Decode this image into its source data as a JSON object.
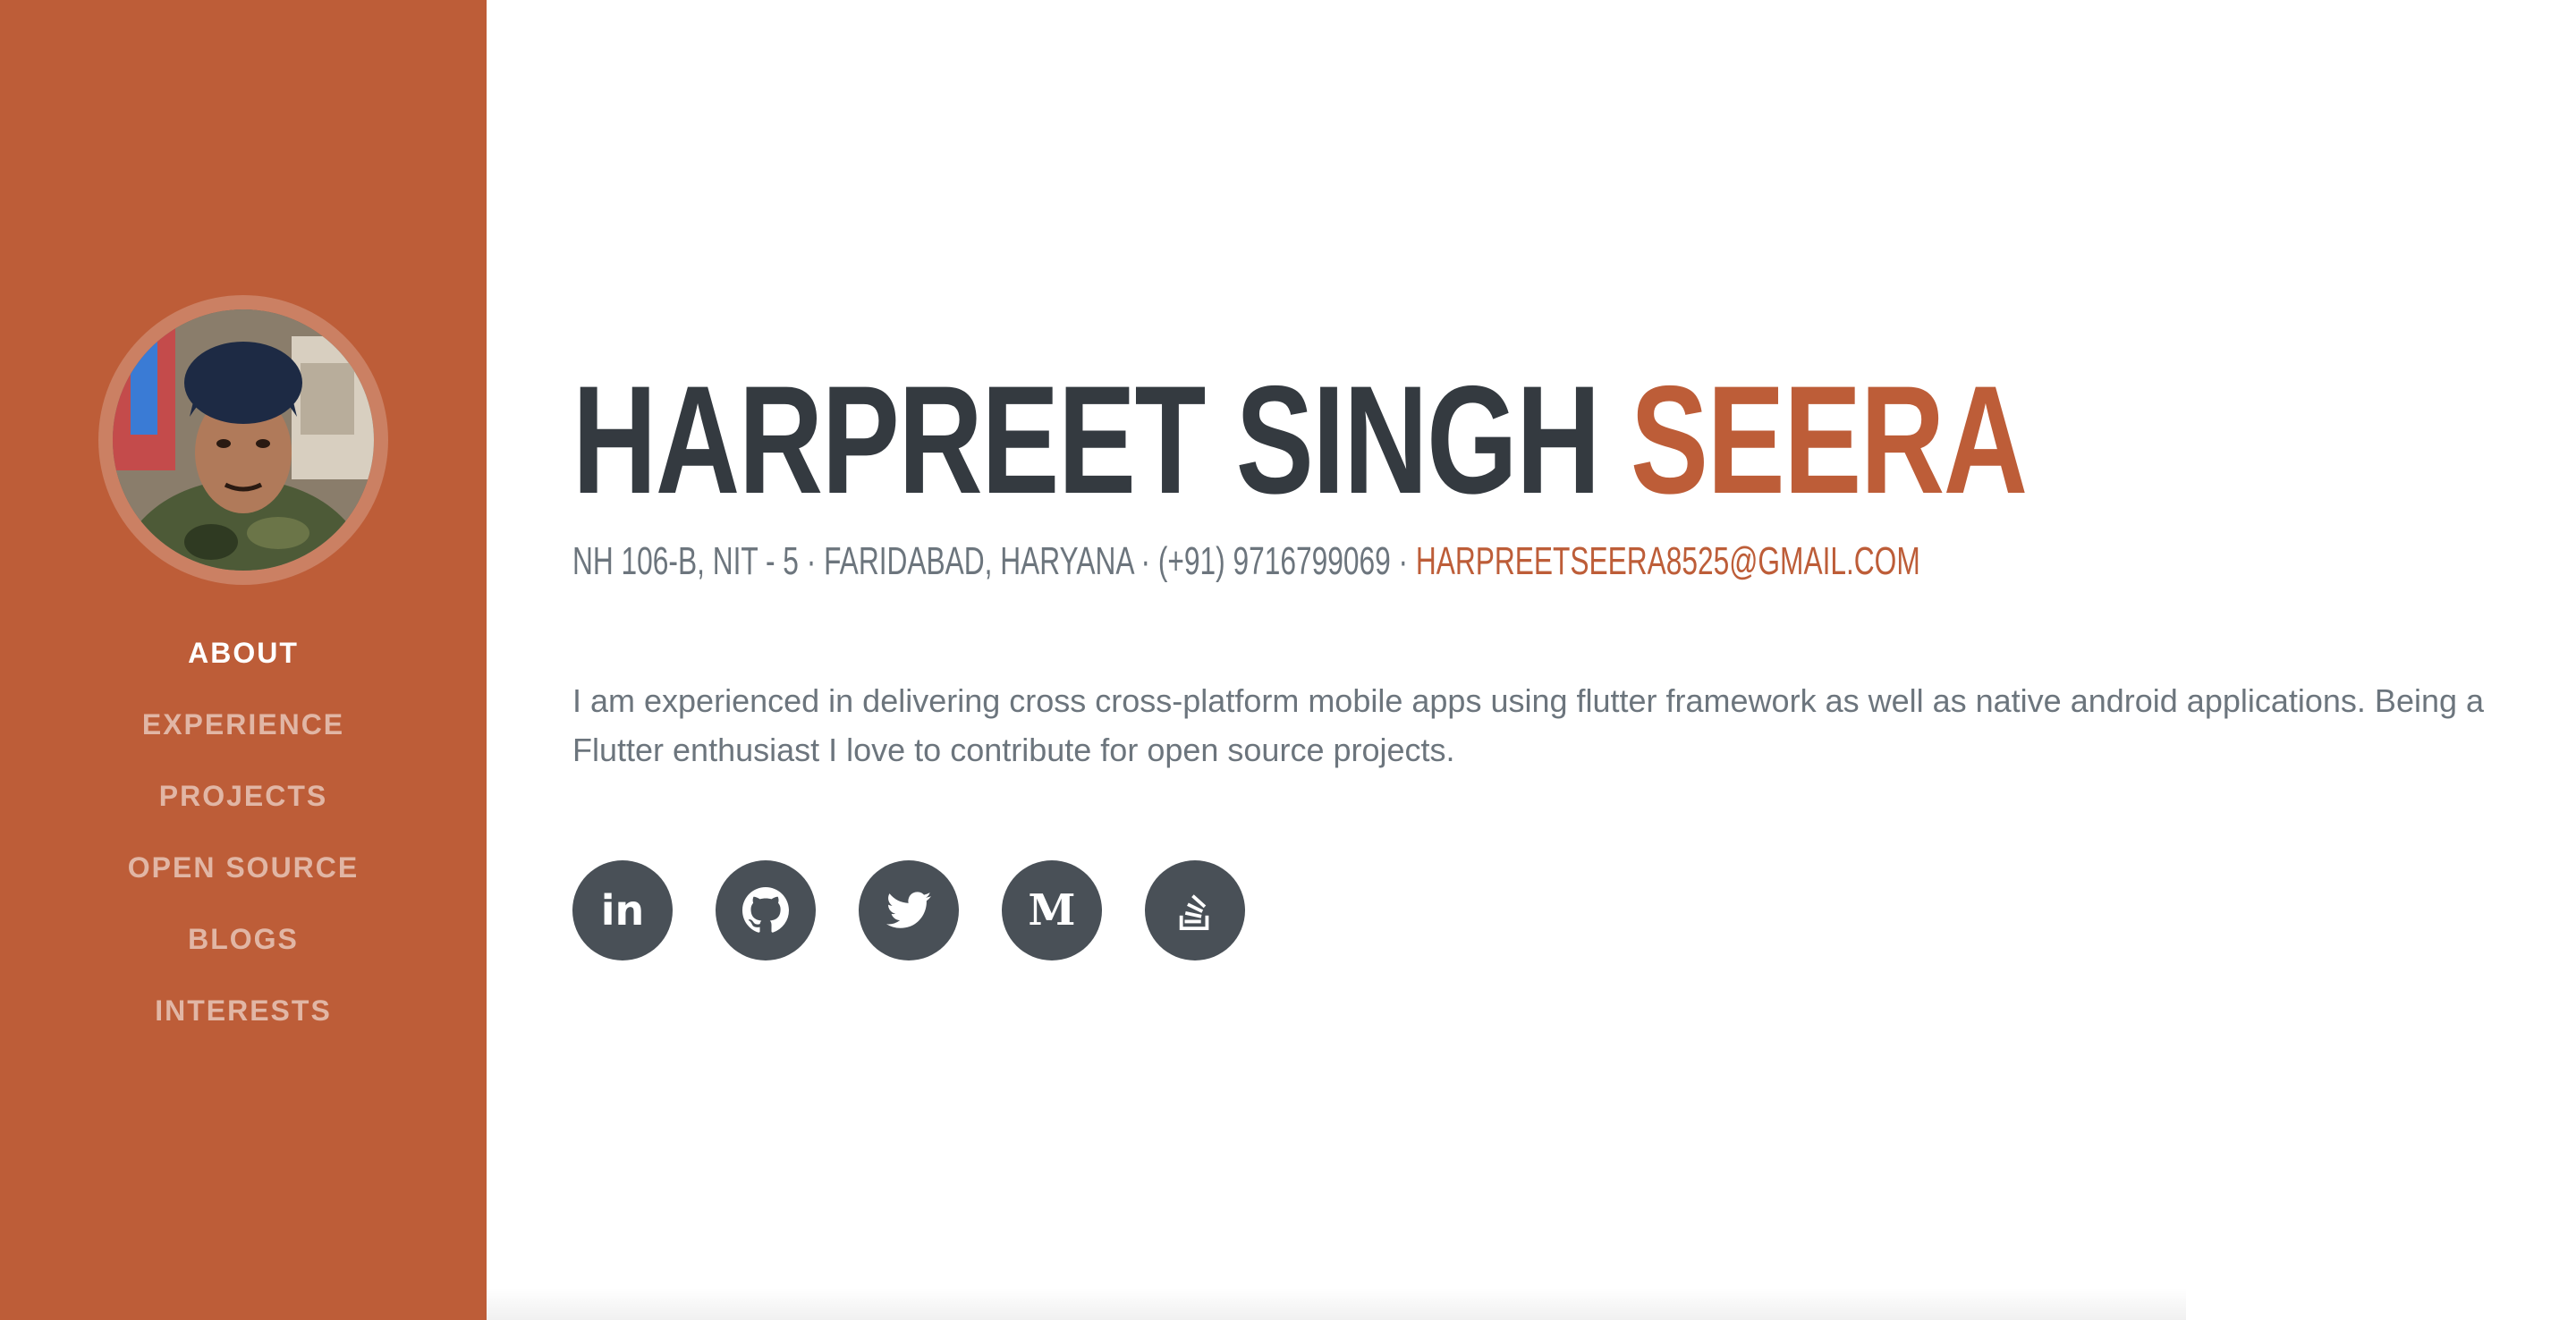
{
  "colors": {
    "primary": "#bd5d38",
    "heading": "#343a40",
    "text": "#6c757d",
    "icon_bg": "#495057"
  },
  "sidebar": {
    "nav": [
      {
        "label": "ABOUT",
        "active": true
      },
      {
        "label": "EXPERIENCE",
        "active": false
      },
      {
        "label": "PROJECTS",
        "active": false
      },
      {
        "label": "OPEN SOURCE",
        "active": false
      },
      {
        "label": "BLOGS",
        "active": false
      },
      {
        "label": "INTERESTS",
        "active": false
      }
    ]
  },
  "about": {
    "first_name": "HARPREET SINGH",
    "last_name": "SEERA",
    "contact": "NH 106-B, NIT - 5 · FARIDABAD, HARYANA · (+91) 9716799069 · ",
    "email": "HARPREETSEERA8525@GMAIL.COM",
    "intro": "I am experienced in delivering cross cross-platform mobile apps using flutter framework as well as native android applications. Being a Flutter enthusiast I love to contribute for open source projects.",
    "social": [
      {
        "icon": "linkedin-icon",
        "glyph": "in"
      },
      {
        "icon": "github-icon",
        "glyph": ""
      },
      {
        "icon": "twitter-icon",
        "glyph": ""
      },
      {
        "icon": "medium-icon",
        "glyph": "M"
      },
      {
        "icon": "stackoverflow-icon",
        "glyph": ""
      }
    ]
  }
}
